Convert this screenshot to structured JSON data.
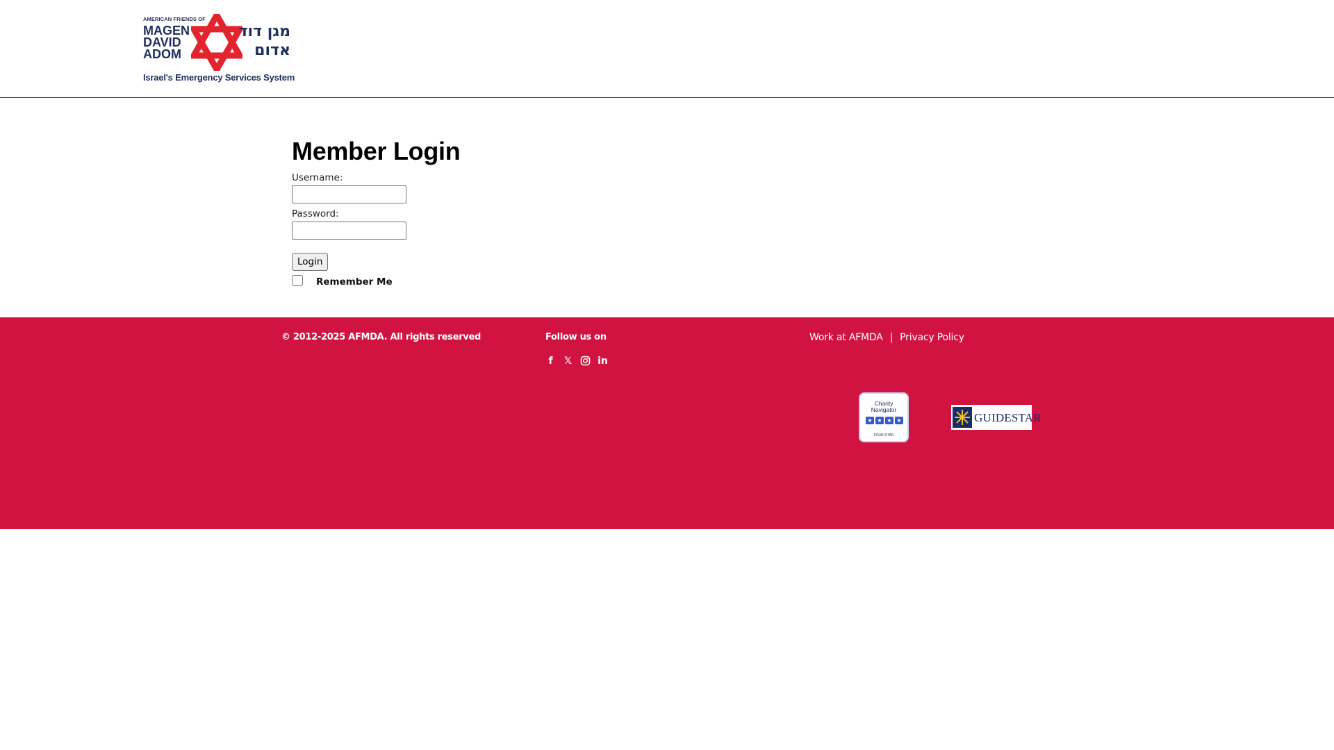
{
  "header": {
    "logo": {
      "small_text": "AMERICAN FRIENDS OF",
      "line1": "MAGEN",
      "line2": "DAVID",
      "line3": "ADOM",
      "hebrew_line1": "מגן דוד",
      "hebrew_line2": "אדום",
      "tagline": "Israel's Emergency Services System",
      "star_color": "#e3232e",
      "text_color": "#1f2e5c"
    }
  },
  "login": {
    "title": "Member Login",
    "username_label": "Username:",
    "username_value": "",
    "password_label": "Password:",
    "password_value": "",
    "login_button": "Login",
    "remember_label": "Remember Me",
    "remember_checked": false
  },
  "footer": {
    "background_color": "#d11342",
    "copyright": "© 2012-2025 AFMDA. All rights reserved",
    "follow_label": "Follow us on",
    "social_icons": [
      "facebook-icon",
      "x-twitter-icon",
      "instagram-icon",
      "linkedin-icon"
    ],
    "links": {
      "work": "Work at AFMDA",
      "separator": "|",
      "privacy": "Privacy Policy"
    },
    "badges": {
      "charity_line1": "Charity",
      "charity_line2": "Navigator",
      "charity_rating": "FOUR-STAR",
      "guidestar": "GUIDESTAR"
    }
  }
}
